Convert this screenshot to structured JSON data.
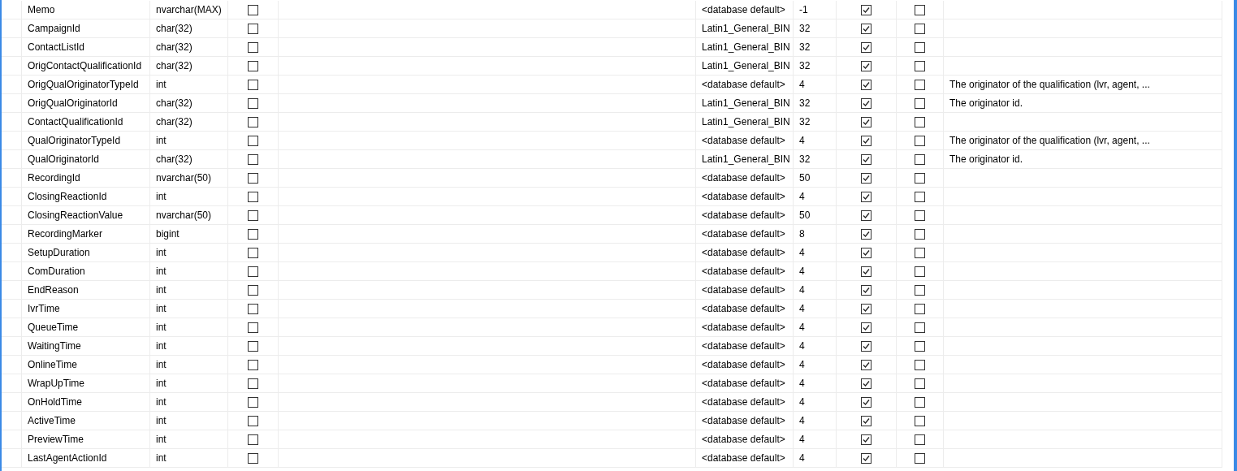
{
  "rows": [
    {
      "column_1": "Memo",
      "column_2": "nvarchar(MAX)",
      "column_3": false,
      "column_5": "<database default>",
      "column_6": "-1",
      "column_7": true,
      "column_8": false
    },
    {
      "column_1": "CampaignId",
      "column_2": "char(32)",
      "column_3": false,
      "column_5": "Latin1_General_BIN",
      "column_6": "32",
      "column_7": true,
      "column_8": false
    },
    {
      "column_1": "ContactListId",
      "column_2": "char(32)",
      "column_3": false,
      "column_5": "Latin1_General_BIN",
      "column_6": "32",
      "column_7": true,
      "column_8": false
    },
    {
      "column_1": "OrigContactQualificationId",
      "column_2": "char(32)",
      "column_3": false,
      "column_5": "Latin1_General_BIN",
      "column_6": "32",
      "column_7": true,
      "column_8": false
    },
    {
      "column_1": "OrigQualOriginatorTypeId",
      "column_2": "int",
      "column_3": false,
      "column_5": "<database default>",
      "column_6": "4",
      "column_7": true,
      "column_8": false,
      "column_9": "The originator of the qualification (lvr, agent, ..."
    },
    {
      "column_1": "OrigQualOriginatorId",
      "column_2": "char(32)",
      "column_3": false,
      "column_5": "Latin1_General_BIN",
      "column_6": "32",
      "column_7": true,
      "column_8": false,
      "column_9": "The originator id."
    },
    {
      "column_1": "ContactQualificationId",
      "column_2": "char(32)",
      "column_3": false,
      "column_5": "Latin1_General_BIN",
      "column_6": "32",
      "column_7": true,
      "column_8": false
    },
    {
      "column_1": "QualOriginatorTypeId",
      "column_2": "int",
      "column_3": false,
      "column_5": "<database default>",
      "column_6": "4",
      "column_7": true,
      "column_8": false,
      "column_9": "The originator of the qualification (lvr, agent, ..."
    },
    {
      "column_1": "QualOriginatorId",
      "column_2": "char(32)",
      "column_3": false,
      "column_5": "Latin1_General_BIN",
      "column_6": "32",
      "column_7": true,
      "column_8": false,
      "column_9": "The originator id."
    },
    {
      "column_1": "RecordingId",
      "column_2": "nvarchar(50)",
      "column_3": false,
      "column_5": "<database default>",
      "column_6": "50",
      "column_7": true,
      "column_8": false
    },
    {
      "column_1": "ClosingReactionId",
      "column_2": "int",
      "column_3": false,
      "column_5": "<database default>",
      "column_6": "4",
      "column_7": true,
      "column_8": false
    },
    {
      "column_1": "ClosingReactionValue",
      "column_2": "nvarchar(50)",
      "column_3": false,
      "column_5": "<database default>",
      "column_6": "50",
      "column_7": true,
      "column_8": false
    },
    {
      "column_1": "RecordingMarker",
      "column_2": "bigint",
      "column_3": false,
      "column_5": "<database default>",
      "column_6": "8",
      "column_7": true,
      "column_8": false
    },
    {
      "column_1": "SetupDuration",
      "column_2": "int",
      "column_3": false,
      "column_5": "<database default>",
      "column_6": "4",
      "column_7": true,
      "column_8": false
    },
    {
      "column_1": "ComDuration",
      "column_2": "int",
      "column_3": false,
      "column_5": "<database default>",
      "column_6": "4",
      "column_7": true,
      "column_8": false
    },
    {
      "column_1": "EndReason",
      "column_2": "int",
      "column_3": false,
      "column_5": "<database default>",
      "column_6": "4",
      "column_7": true,
      "column_8": false
    },
    {
      "column_1": "IvrTime",
      "column_2": "int",
      "column_3": false,
      "column_5": "<database default>",
      "column_6": "4",
      "column_7": true,
      "column_8": false
    },
    {
      "column_1": "QueueTime",
      "column_2": "int",
      "column_3": false,
      "column_5": "<database default>",
      "column_6": "4",
      "column_7": true,
      "column_8": false
    },
    {
      "column_1": "WaitingTime",
      "column_2": "int",
      "column_3": false,
      "column_5": "<database default>",
      "column_6": "4",
      "column_7": true,
      "column_8": false
    },
    {
      "column_1": "OnlineTime",
      "column_2": "int",
      "column_3": false,
      "column_5": "<database default>",
      "column_6": "4",
      "column_7": true,
      "column_8": false
    },
    {
      "column_1": "WrapUpTime",
      "column_2": "int",
      "column_3": false,
      "column_5": "<database default>",
      "column_6": "4",
      "column_7": true,
      "column_8": false
    },
    {
      "column_1": "OnHoldTime",
      "column_2": "int",
      "column_3": false,
      "column_5": "<database default>",
      "column_6": "4",
      "column_7": true,
      "column_8": false
    },
    {
      "column_1": "ActiveTime",
      "column_2": "int",
      "column_3": false,
      "column_5": "<database default>",
      "column_6": "4",
      "column_7": true,
      "column_8": false
    },
    {
      "column_1": "PreviewTime",
      "column_2": "int",
      "column_3": false,
      "column_5": "<database default>",
      "column_6": "4",
      "column_7": true,
      "column_8": false
    },
    {
      "column_1": "LastAgentActionId",
      "column_2": "int",
      "column_3": false,
      "column_5": "<database default>",
      "column_6": "4",
      "column_7": true,
      "column_8": false
    }
  ]
}
